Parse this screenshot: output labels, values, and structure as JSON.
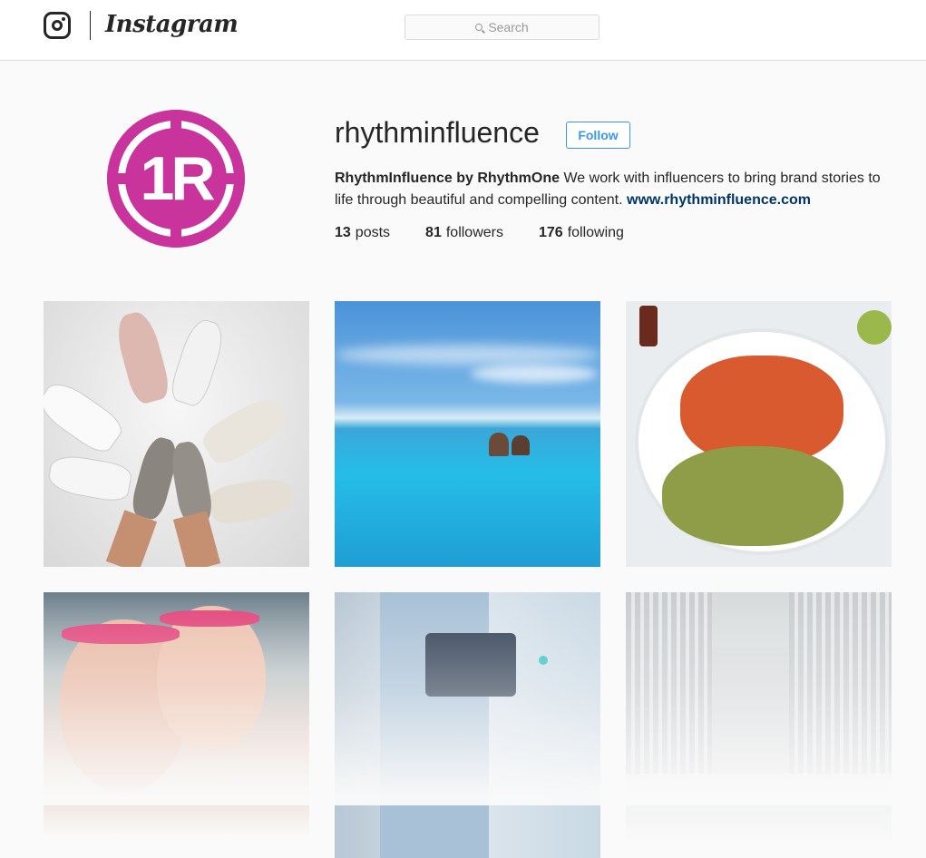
{
  "header": {
    "wordmark": "Instagram",
    "search_placeholder": "Search",
    "icon": "instagram-camera-icon"
  },
  "profile": {
    "username": "rhythminfluence",
    "follow_label": "Follow",
    "avatar_text": "1R",
    "bio_name": "RhythmInfluence by RhythmOne",
    "bio_text": " We work with influencers to bring brand stories to life through beautiful and compelling content. ",
    "bio_link": "www.rhythminfluence.com",
    "stats": [
      {
        "count": "13",
        "label": "posts"
      },
      {
        "count": "81",
        "label": "followers"
      },
      {
        "count": "176",
        "label": "following"
      }
    ]
  },
  "colors": {
    "avatar": "#c8339c",
    "follow": "#3897f0",
    "link": "#003569"
  },
  "posts": [
    {
      "subject": "sneakers-circle-photo"
    },
    {
      "subject": "infinity-pool-photo"
    },
    {
      "subject": "lobster-platter-photo"
    },
    {
      "subject": "runners-selfie-photo"
    },
    {
      "subject": "handbag-street-photo"
    },
    {
      "subject": "city-building-photo"
    }
  ]
}
